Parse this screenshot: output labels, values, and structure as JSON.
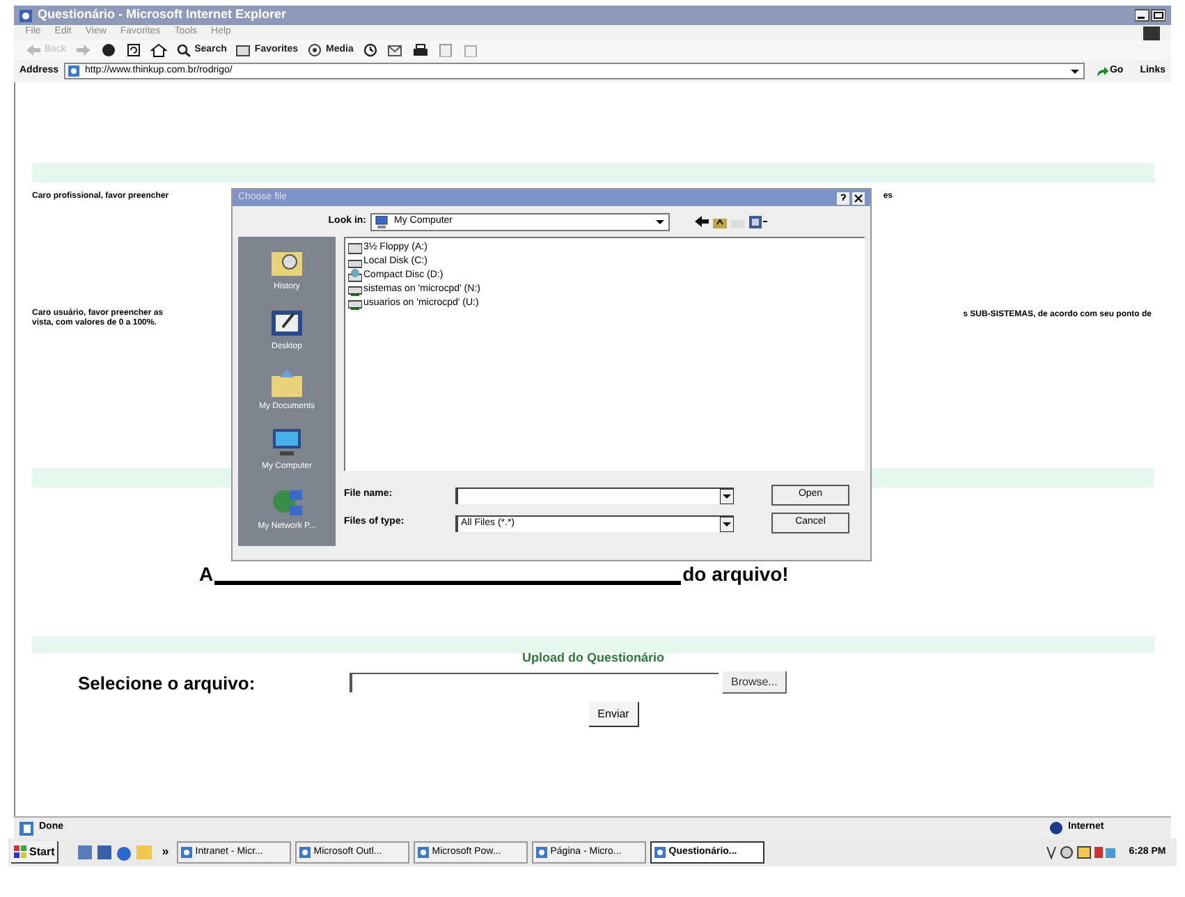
{
  "browser": {
    "title": "Questionário - Microsoft Internet Explorer",
    "menu": [
      "File",
      "Edit",
      "View",
      "Favorites",
      "Tools",
      "Help"
    ],
    "toolbar": [
      {
        "kind": "back",
        "label": "Back"
      },
      {
        "kind": "forward"
      },
      {
        "kind": "stop"
      },
      {
        "kind": "refresh"
      },
      {
        "kind": "home"
      },
      {
        "kind": "search",
        "label": "Search"
      },
      {
        "kind": "favorites",
        "label": "Favorites"
      },
      {
        "kind": "media",
        "label": "Media"
      },
      {
        "kind": "history"
      },
      {
        "kind": "mail"
      },
      {
        "kind": "print"
      },
      {
        "kind": "edit"
      },
      {
        "kind": "discuss"
      }
    ],
    "address_label": "Address",
    "url": "http://www.thinkup.com.br/rodrigo/",
    "go": "Go",
    "links": "Links"
  },
  "page": {
    "intro_professional": "Caro profissional, favor preencher",
    "intro_professional_end": "es",
    "intro_user": [
      "Caro usuário, favor preencher as",
      "vista, com valores de 0 a 100%."
    ],
    "intro_user_end": "s SUB-SISTEMAS, de acordo com seu ponto de",
    "notice_start": "A",
    "notice_end": "do arquivo!",
    "upload_heading": "Upload do Questionário",
    "file_label": "Selecione o arquivo:",
    "browse": "Browse...",
    "submit": "Enviar"
  },
  "dialog": {
    "title": "Choose file",
    "look_in_label": "Look in:",
    "look_in": "My Computer",
    "places": [
      "History",
      "Desktop",
      "My Documents",
      "My Computer",
      "My Network P..."
    ],
    "files": [
      {
        "kind": "floppy",
        "label": "3½ Floppy (A:)"
      },
      {
        "kind": "disk",
        "label": "Local Disk (C:)"
      },
      {
        "kind": "cd",
        "label": "Compact Disc (D:)"
      },
      {
        "kind": "network",
        "label": "sistemas on 'microcpd' (N:)"
      },
      {
        "kind": "network",
        "label": "usuarios on 'microcpd' (U:)"
      }
    ],
    "file_name_label": "File name:",
    "file_type_label": "Files of type:",
    "file_type": "All Files (*.*)",
    "open": "Open",
    "cancel": "Cancel"
  },
  "status_bar": {
    "text": "Done",
    "zone": "Internet"
  },
  "taskbar": {
    "start": "Start",
    "more": "»",
    "tasks": [
      {
        "label": "Intranet - Micr...",
        "selected": false
      },
      {
        "label": "Microsoft Outl...",
        "selected": false
      },
      {
        "label": "Microsoft Pow...",
        "selected": false
      },
      {
        "label": "Página - Micro...",
        "selected": false
      },
      {
        "label": "Questionário...",
        "selected": true
      }
    ],
    "clock": "6:28 PM"
  }
}
